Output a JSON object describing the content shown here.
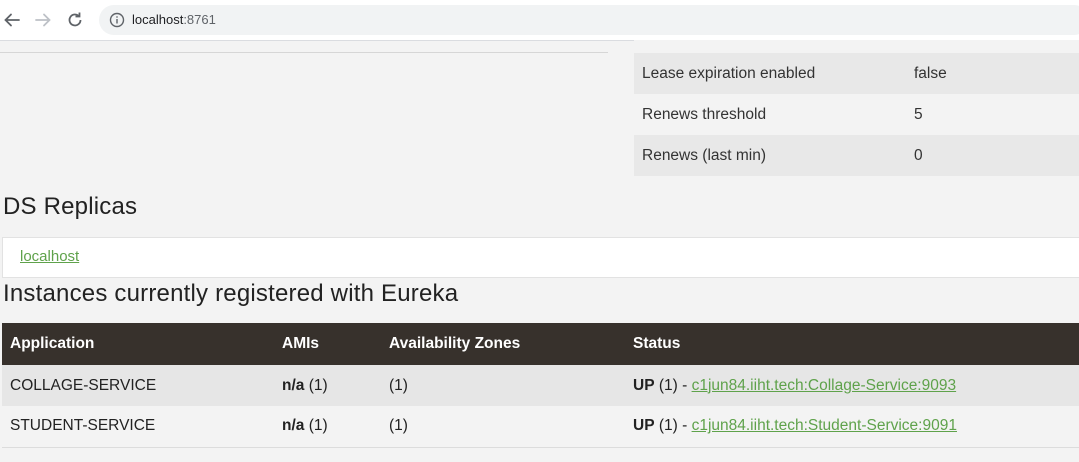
{
  "browser": {
    "url_host": "localhost",
    "url_port": ":8761"
  },
  "info_table": {
    "partial_label": "",
    "rows": [
      {
        "label": "Lease expiration enabled",
        "value": "false"
      },
      {
        "label": "Renews threshold",
        "value": "5"
      },
      {
        "label": "Renews (last min)",
        "value": "0"
      }
    ]
  },
  "ds_replicas": {
    "title": "DS Replicas",
    "link": "localhost"
  },
  "instances": {
    "title": "Instances currently registered with Eureka",
    "headers": {
      "application": "Application",
      "amis": "AMIs",
      "zones": "Availability Zones",
      "status": "Status"
    },
    "rows": [
      {
        "application": "COLLAGE-SERVICE",
        "amis_bold": "n/a",
        "amis_count": "(1)",
        "zones": "(1)",
        "status_bold": "UP",
        "status_count": "(1) - ",
        "status_link": "c1jun84.iiht.tech:Collage-Service:9093"
      },
      {
        "application": "STUDENT-SERVICE",
        "amis_bold": "n/a",
        "amis_count": "(1)",
        "zones": "(1)",
        "status_bold": "UP",
        "status_count": "(1) - ",
        "status_link": "c1jun84.iiht.tech:Student-Service:9091"
      }
    ]
  }
}
